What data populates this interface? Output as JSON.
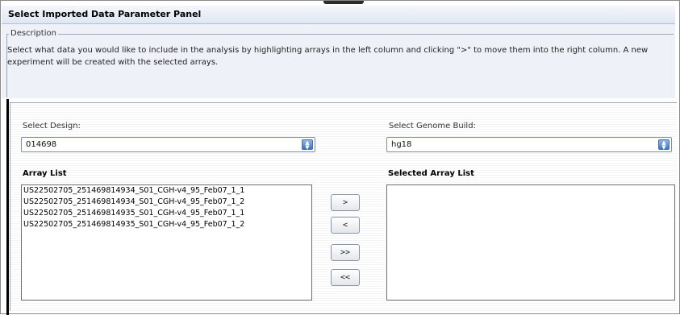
{
  "panel": {
    "title": "Select Imported Data Parameter Panel"
  },
  "description": {
    "legend": "Description",
    "text": "Select what data you would like to include in the analysis by highlighting arrays in the left column and clicking \">\" to move them into the right column. A new experiment will be created with the selected arrays."
  },
  "design": {
    "label": "Select Design:",
    "value": "014698"
  },
  "genome": {
    "label": "Select Genome Build:",
    "value": "hg18"
  },
  "array_list": {
    "label": "Array List",
    "items": [
      "US22502705_251469814934_S01_CGH-v4_95_Feb07_1_1",
      "US22502705_251469814934_S01_CGH-v4_95_Feb07_1_2",
      "US22502705_251469814935_S01_CGH-v4_95_Feb07_1_1",
      "US22502705_251469814935_S01_CGH-v4_95_Feb07_1_2"
    ]
  },
  "selected_array_list": {
    "label": "Selected Array List",
    "items": []
  },
  "buttons": {
    "add": ">",
    "remove": "<",
    "add_all": ">>",
    "remove_all": "<<"
  },
  "icons": {
    "select_arrow": "up-down-arrows-icon"
  }
}
